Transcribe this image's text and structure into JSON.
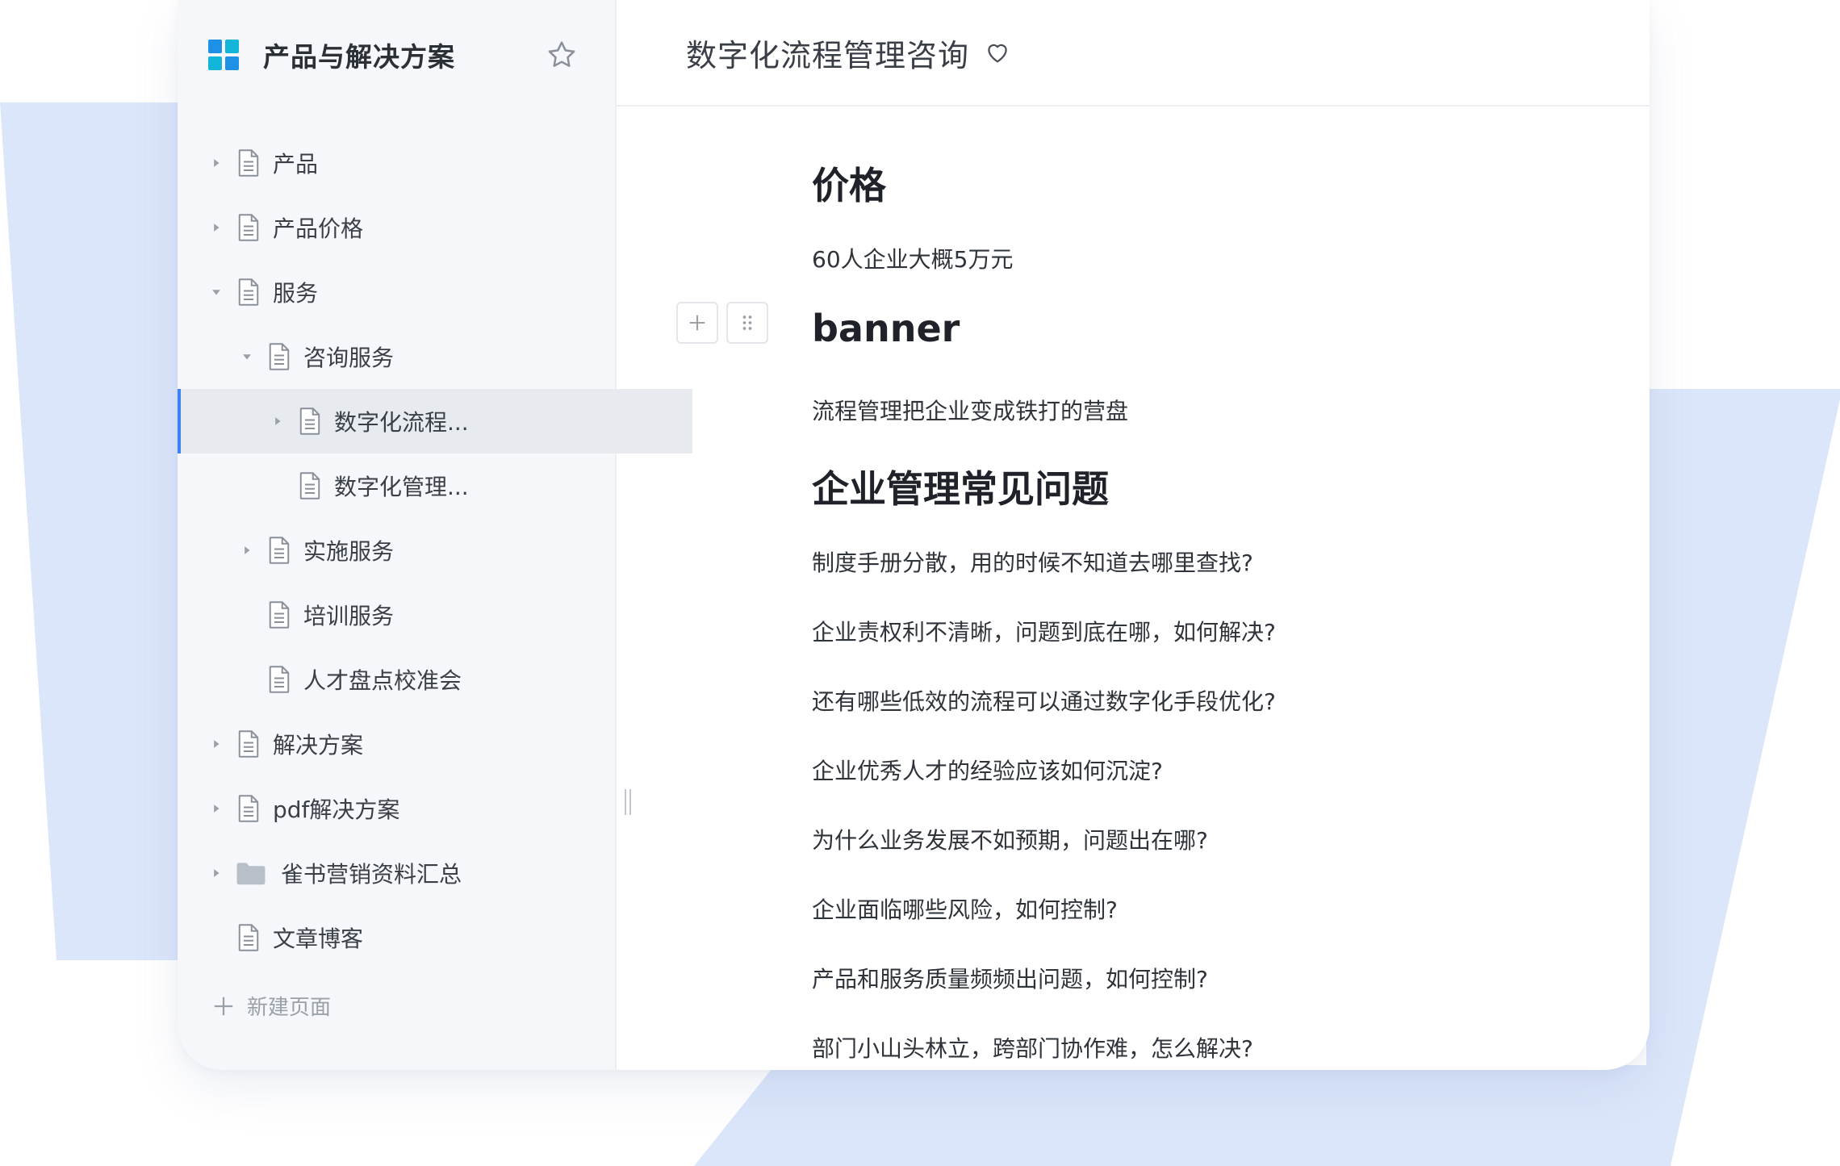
{
  "sidebar": {
    "space_title": "产品与解决方案",
    "items": [
      {
        "label": "产品",
        "depth": 0,
        "caret": "right",
        "icon": "doc"
      },
      {
        "label": "产品价格",
        "depth": 0,
        "caret": "right",
        "icon": "doc"
      },
      {
        "label": "服务",
        "depth": 0,
        "caret": "down",
        "icon": "doc"
      },
      {
        "label": "咨询服务",
        "depth": 1,
        "caret": "down",
        "icon": "doc"
      },
      {
        "label": "数字化流程...",
        "depth": 2,
        "caret": "right",
        "icon": "doc",
        "selected": true
      },
      {
        "label": "数字化管理...",
        "depth": 2,
        "caret": "none",
        "icon": "doc"
      },
      {
        "label": "实施服务",
        "depth": 1,
        "caret": "right",
        "icon": "doc"
      },
      {
        "label": "培训服务",
        "depth": 1,
        "caret": "none",
        "icon": "doc"
      },
      {
        "label": "人才盘点校准会",
        "depth": 1,
        "caret": "none",
        "icon": "doc"
      },
      {
        "label": "解决方案",
        "depth": 0,
        "caret": "right",
        "icon": "doc"
      },
      {
        "label": "pdf解决方案",
        "depth": 0,
        "caret": "right",
        "icon": "doc"
      },
      {
        "label": "雀书营销资料汇总",
        "depth": 0,
        "caret": "right",
        "icon": "folder"
      },
      {
        "label": "文章博客",
        "depth": 0,
        "caret": "none",
        "icon": "doc"
      }
    ],
    "new_page_label": "新建页面"
  },
  "document": {
    "title": "数字化流程管理咨询",
    "blocks": {
      "h_price": "价格",
      "p_price": "60人企业大概5万元",
      "h_banner": "banner",
      "p_banner": "流程管理把企业变成铁打的营盘",
      "h_faq": "企业管理常见问题",
      "q1": "制度手册分散，用的时候不知道去哪里查找?",
      "q2": "企业责权利不清晰，问题到底在哪，如何解决?",
      "q3": "还有哪些低效的流程可以通过数字化手段优化?",
      "q4": "企业优秀人才的经验应该如何沉淀?",
      "q5": "为什么业务发展不如预期，问题出在哪?",
      "q6": "企业面临哪些风险，如何控制?",
      "q7": "产品和服务质量频频出问题，如何控制?",
      "q8": "部门小山头林立，跨部门协作难，怎么解决?"
    }
  },
  "colors": {
    "accent": "#3b82f6",
    "background_shape": "#dbe6fb",
    "logo_blue": "#1e90e6",
    "logo_cyan": "#13b5d8"
  },
  "icons": [
    "grid-logo-icon",
    "star-icon",
    "caret-right-icon",
    "caret-down-icon",
    "document-icon",
    "folder-icon",
    "plus-icon",
    "heart-icon",
    "drag-handle-icon",
    "resize-handle-icon"
  ]
}
